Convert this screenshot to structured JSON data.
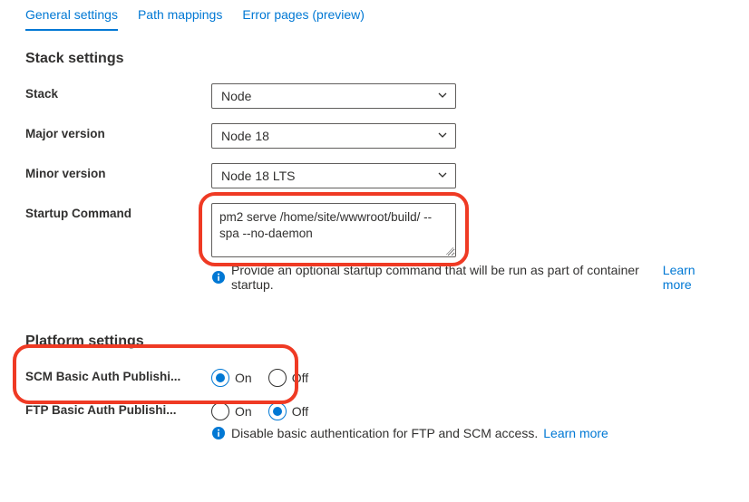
{
  "tabs": {
    "general": "General settings",
    "path": "Path mappings",
    "error": "Error pages (preview)"
  },
  "sections": {
    "stack": "Stack settings",
    "platform": "Platform settings"
  },
  "stack": {
    "label": "Stack",
    "value": "Node"
  },
  "major": {
    "label": "Major version",
    "value": "Node 18"
  },
  "minor": {
    "label": "Minor version",
    "value": "Node 18 LTS"
  },
  "startup": {
    "label": "Startup Command",
    "value": "pm2 serve /home/site/wwwroot/build/ --spa --no-daemon",
    "info": "Provide an optional startup command that will be run as part of container startup.",
    "learn": "Learn more"
  },
  "scm": {
    "label": "SCM Basic Auth Publishi...",
    "on": "On",
    "off": "Off",
    "selected": "on"
  },
  "ftp": {
    "label": "FTP Basic Auth Publishi...",
    "on": "On",
    "off": "Off",
    "selected": "off",
    "info": "Disable basic authentication for FTP and SCM access.",
    "learn": "Learn more"
  }
}
